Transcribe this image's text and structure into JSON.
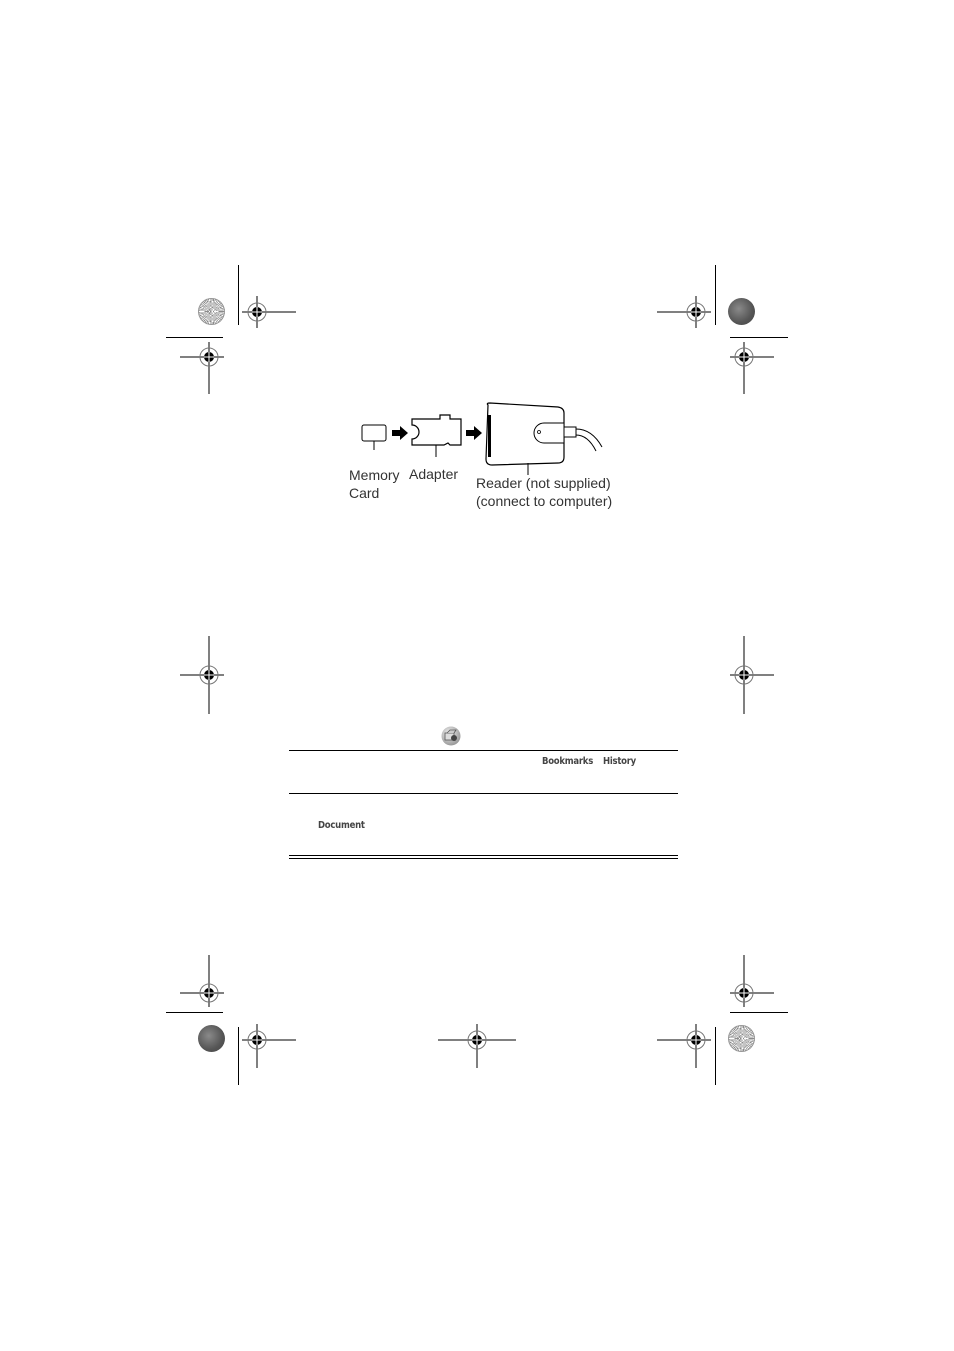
{
  "figure": {
    "labels": {
      "memory_card_line1": "Memory",
      "memory_card_line2": "Card",
      "adapter": "Adapter",
      "reader_line1": "Reader (not supplied)",
      "reader_line2": "(connect to computer)"
    },
    "parts": [
      "memory-card",
      "adapter",
      "card-reader",
      "usb-cable"
    ]
  },
  "table": {
    "header_icon": "browser-icon",
    "row1_keywords": [
      "Bookmarks",
      "History"
    ],
    "row2_keyword": "Document"
  },
  "print_marks": {
    "registration_mark": "crosshair-target-icon",
    "color_disc_light": "radial-starburst-disc",
    "color_disc_dark": "gray-density-disc"
  }
}
